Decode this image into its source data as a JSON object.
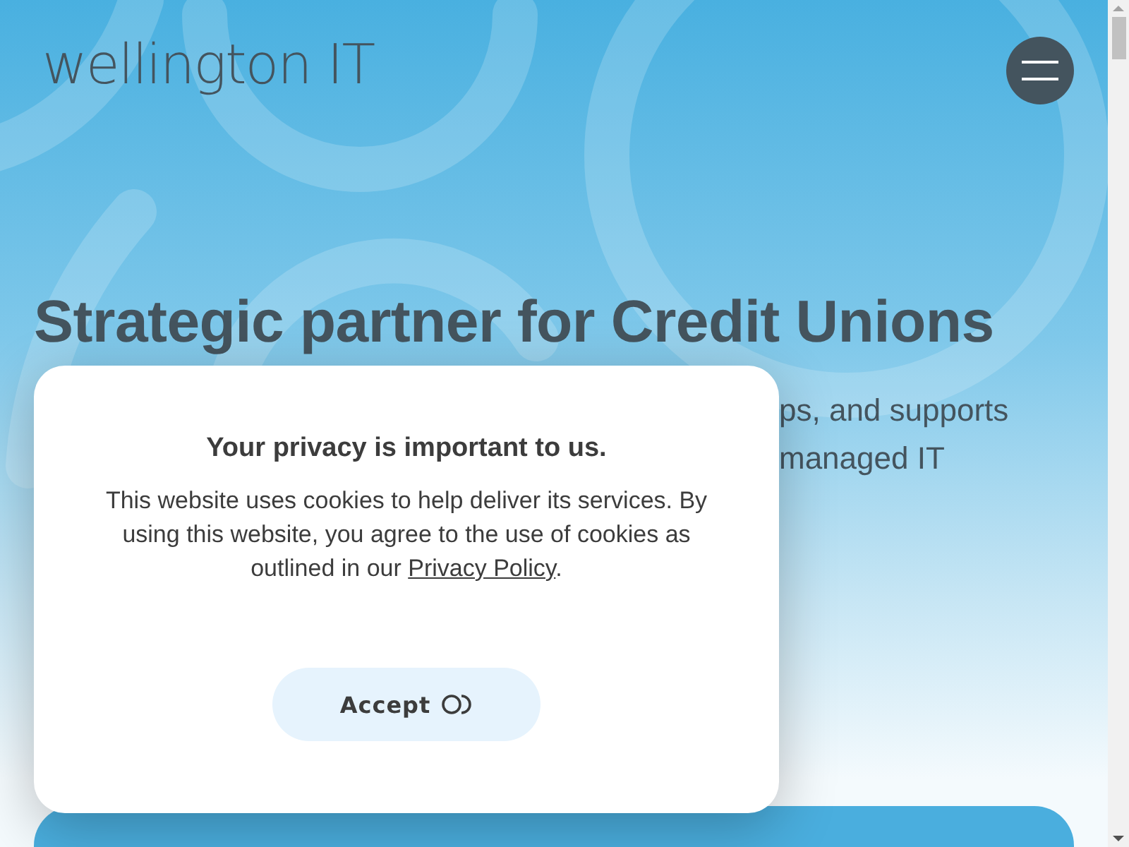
{
  "header": {
    "logo": "wellington IT"
  },
  "hero": {
    "title": "Strategic partner for Credit Unions",
    "subtitle_lines": [
      "ps, and supports",
      "managed IT"
    ]
  },
  "consent": {
    "heading": "Your privacy is important to us.",
    "body_before": "This website uses cookies to help deliver its services. By using this website, you agree to the use of cookies as outlined in our ",
    "link": "Privacy Policy",
    "body_after": ".",
    "button": "Accept"
  }
}
